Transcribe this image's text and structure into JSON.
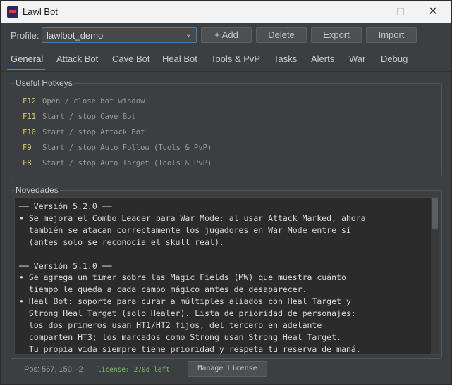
{
  "window": {
    "title": "Lawl Bot",
    "icon": "app-icon"
  },
  "profile": {
    "label": "Profile:",
    "selected": "lawlbot_demo",
    "buttons": {
      "add": "+ Add",
      "delete": "Delete",
      "export": "Export",
      "import": "Import"
    }
  },
  "tabs": [
    "General",
    "Attack Bot",
    "Cave Bot",
    "Heal Bot",
    "Tools & PvP",
    "Tasks",
    "Alerts",
    "War",
    "Debug"
  ],
  "active_tab": "General",
  "hotkeys": {
    "title": "Useful Hotkeys",
    "items": [
      {
        "key": "F12",
        "desc": "Open / close bot window"
      },
      {
        "key": "F11",
        "desc": "Start / stop Cave Bot"
      },
      {
        "key": "F10",
        "desc": "Start / stop Attack Bot"
      },
      {
        "key": "F9",
        "desc": "Start / stop Auto Follow (Tools & PvP)"
      },
      {
        "key": "F8",
        "desc": "Start / stop Auto Target (Tools & PvP)"
      }
    ]
  },
  "news": {
    "title": "Novedades",
    "lines": [
      "── Versión 5.2.0 ──",
      "• Se mejora el Combo Leader para War Mode: al usar Attack Marked, ahora",
      "  también se atacan correctamente los jugadores en War Mode entre sí",
      "  (antes solo se reconocía el skull real).",
      "",
      "── Versión 5.1.0 ──",
      "• Se agrega un timer sobre las Magic Fields (MW) que muestra cuánto",
      "  tiempo le queda a cada campo mágico antes de desaparecer.",
      "• Heal Bot: soporte para curar a múltiples aliados con Heal Target y",
      "  Strong Heal Target (solo Healer). Lista de prioridad de personajes:",
      "  los dos primeros usan HT1/HT2 fijos, del tercero en adelante",
      "  comparten HT3; los marcados como Strong usan Strong Heal Target.",
      "  Tu propia vida siempre tiene prioridad y respeta tu reserva de maná."
    ]
  },
  "status": {
    "position": "Pos: 567, 150, -2",
    "license": "license: 270d left",
    "manage_button": "Manage License"
  }
}
